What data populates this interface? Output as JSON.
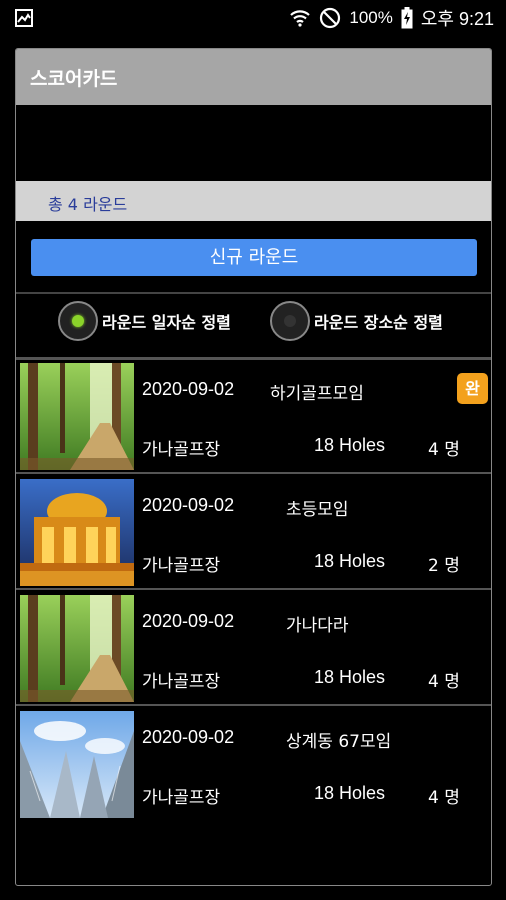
{
  "statusbar": {
    "battery": "100%",
    "time": "오후 9:21"
  },
  "header": {
    "title": "스코어카드"
  },
  "summary": {
    "text": "총 4 라운드"
  },
  "new_round_button": "신규 라운드",
  "sort": {
    "option1": {
      "label": "라운드 일자순 정렬",
      "selected": true
    },
    "option2": {
      "label": "라운드 장소순 정렬",
      "selected": false
    }
  },
  "rounds": [
    {
      "date": "2020-09-02",
      "name": "하기골프모임",
      "course": "가나골프장",
      "holes": "18 Holes",
      "players": "4 명",
      "badge": "완",
      "thumb": "forest"
    },
    {
      "date": "2020-09-02",
      "name": "초등모임",
      "course": "가나골프장",
      "holes": "18 Holes",
      "players": "2 명",
      "badge": "",
      "thumb": "palace"
    },
    {
      "date": "2020-09-02",
      "name": "가나다라",
      "course": "가나골프장",
      "holes": "18 Holes",
      "players": "4 명",
      "badge": "",
      "thumb": "forest"
    },
    {
      "date": "2020-09-02",
      "name": "상계동 67모임",
      "course": "가나골프장",
      "holes": "18 Holes",
      "players": "4 명",
      "badge": "",
      "thumb": "skyscraper"
    }
  ],
  "colors": {
    "titlebar": "#a6a6a6",
    "summary_bg": "#d3d3d3",
    "summary_text": "#2a3d9a",
    "button": "#4a8ff0",
    "badge": "#f3a11d",
    "radio_selected": "#8bd42a"
  }
}
